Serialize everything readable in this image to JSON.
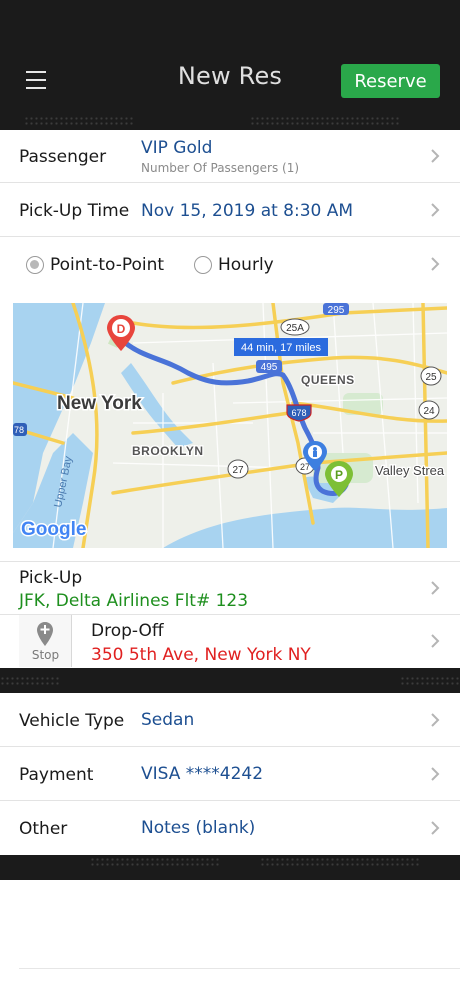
{
  "header": {
    "title": "New Res",
    "reserve_label": "Reserve"
  },
  "passenger": {
    "label": "Passenger",
    "value": "VIP Gold",
    "sub": "Number Of Passengers (1)"
  },
  "pickup_time": {
    "label": "Pick-Up Time",
    "value": "Nov 15, 2019 at 8:30 AM"
  },
  "service_type": {
    "options": [
      "Point-to-Point",
      "Hourly"
    ],
    "selected": "Point-to-Point"
  },
  "map": {
    "route_label": "44 min, 17 miles",
    "places": {
      "new_york": "New York",
      "brooklyn": "BROOKLYN",
      "queens": "QUEENS",
      "upper_bay": "Upper Bay",
      "valley_stream": "Valley Strea"
    },
    "shields": [
      "295",
      "25A",
      "495",
      "678",
      "25",
      "24",
      "27",
      "27",
      "78"
    ],
    "attribution": "Google",
    "markers": {
      "dropoff": "D",
      "pickup": "P"
    }
  },
  "pickup": {
    "label": "Pick-Up",
    "value": "JFK, Delta Airlines Flt# 123",
    "color": "#1e8f1e"
  },
  "dropoff": {
    "label": "Drop-Off",
    "value": "350 5th Ave, New York NY",
    "color": "#e02020",
    "stop_label": "Stop"
  },
  "vehicle": {
    "label": "Vehicle Type",
    "value": "Sedan"
  },
  "payment": {
    "label": "Payment",
    "value": "VISA ****4242"
  },
  "other": {
    "label": "Other",
    "value": "Notes (blank)"
  },
  "colors": {
    "header_bg": "#1b1b1b",
    "accent_green": "#2aa84a",
    "value_blue": "#1d4f91",
    "route_blue": "#4a73d8"
  }
}
